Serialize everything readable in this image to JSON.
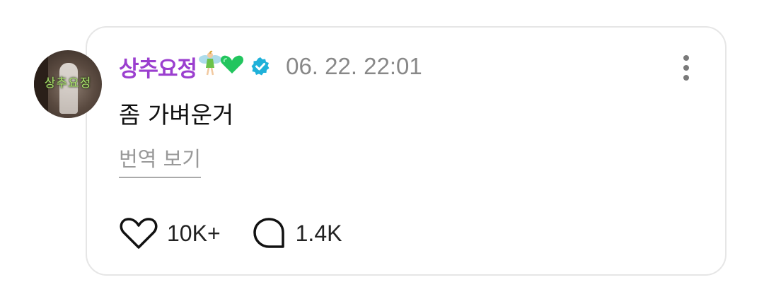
{
  "post": {
    "avatar_text": "상추요정",
    "username": "상추요정",
    "username_emojis": "🧚💚",
    "verified_icon": "verified-badge-icon",
    "timestamp": "06. 22. 22:01",
    "body": "좀 가벼운거",
    "translate_label": "번역 보기",
    "likes": "10K+",
    "comments": "1.4K",
    "more_icon": "more-vertical-icon"
  },
  "colors": {
    "username": "#9b3fcf",
    "verified": "#1fb1d9",
    "muted": "#888888",
    "text": "#111111",
    "card_border": "#e6e6e6"
  }
}
